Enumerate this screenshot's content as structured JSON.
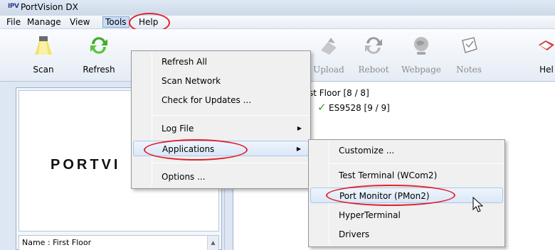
{
  "window": {
    "title": "PortVision DX",
    "app_icon_text": "IPV"
  },
  "menubar": {
    "items": [
      "File",
      "Manage",
      "View",
      "Tools",
      "Help"
    ]
  },
  "toolbar": {
    "left_buttons": [
      {
        "label": "Scan",
        "icon": "scan-icon"
      },
      {
        "label": "Refresh",
        "icon": "refresh-icon"
      }
    ],
    "right_buttons": [
      {
        "label": "Upload",
        "icon": "upload-icon"
      },
      {
        "label": "Reboot",
        "icon": "reboot-icon"
      },
      {
        "label": "Webpage",
        "icon": "webpage-icon"
      },
      {
        "label": "Notes",
        "icon": "notes-icon"
      },
      {
        "label": "Hel",
        "icon": "help-icon"
      }
    ]
  },
  "left_pane": {
    "logo_text": "PORTVI",
    "name_field": "Name : First Floor"
  },
  "tree": {
    "floor": "st Floor [8 / 8]",
    "device": "ES9528 [9 / 9]"
  },
  "tools_menu": {
    "items": [
      "Refresh All",
      "Scan Network",
      "Check for Updates ...",
      "Log File",
      "Applications",
      "Options ..."
    ],
    "highlighted": "Applications"
  },
  "applications_menu": {
    "items": [
      "Customize ...",
      "Test Terminal (WCom2)",
      "Port Monitor (PMon2)",
      "HyperTerminal",
      "Drivers"
    ],
    "highlighted": "Port Monitor (PMon2)"
  },
  "colors": {
    "annotation_circle": "#e3202c",
    "check": "#2e9c1a"
  }
}
